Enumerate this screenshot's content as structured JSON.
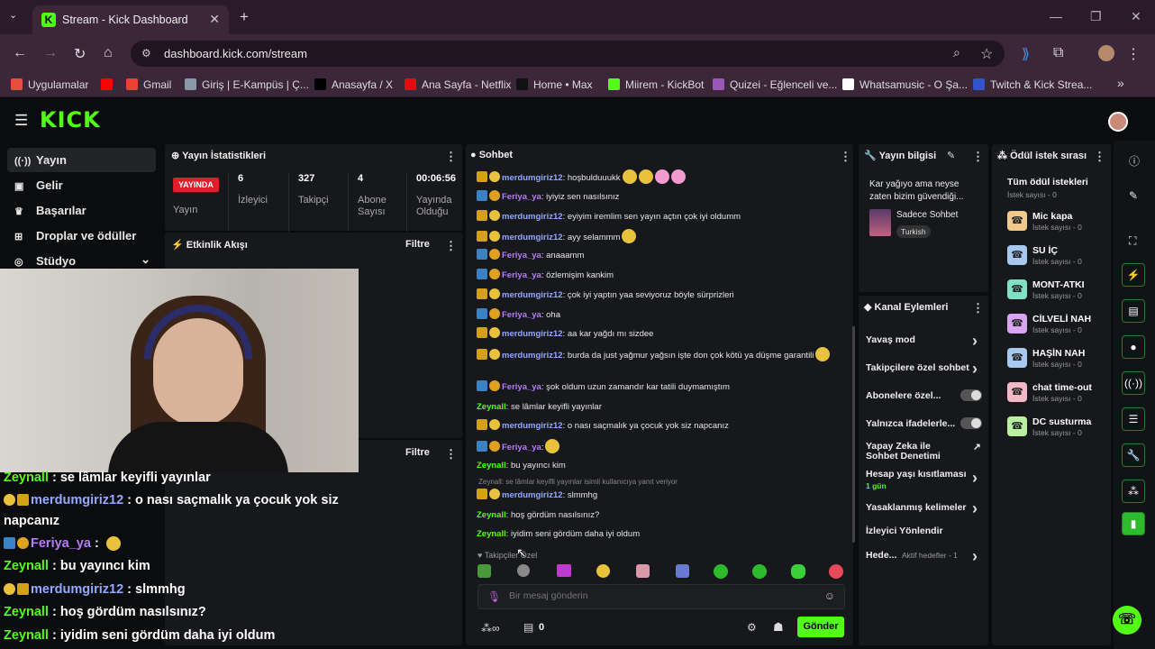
{
  "browser": {
    "tab_title": "Stream - Kick Dashboard",
    "url": "dashboard.kick.com/stream",
    "bookmarks": [
      {
        "label": "Uygulamalar",
        "color": "#e74c3c"
      },
      {
        "label": "",
        "color": "#ff0000"
      },
      {
        "label": "Gmail",
        "color": "#ea4335"
      },
      {
        "label": "Giriş | E-Kampüs | Ç...",
        "color": "#8899aa"
      },
      {
        "label": "Anasayfa / X",
        "color": "#000000"
      },
      {
        "label": "Ana Sayfa - Netflix",
        "color": "#e50914"
      },
      {
        "label": "Home • Max",
        "color": "#111111"
      },
      {
        "label": "Miirem - KickBot",
        "color": "#53fc18"
      },
      {
        "label": "Quizei - Eğlenceli ve...",
        "color": "#9b59b6"
      },
      {
        "label": "Whatsamusic - O Şa...",
        "color": "#ffffff"
      },
      {
        "label": "Twitch & Kick Strea...",
        "color": "#3355cc"
      }
    ]
  },
  "sidebar": {
    "items": [
      {
        "label": "Yayın",
        "icon": "broadcast-icon"
      },
      {
        "label": "Gelir",
        "icon": "revenue-icon"
      },
      {
        "label": "Başarılar",
        "icon": "trophy-icon"
      },
      {
        "label": "Droplar ve ödüller",
        "icon": "drops-icon"
      },
      {
        "label": "Stüdyo",
        "icon": "studio-icon"
      }
    ]
  },
  "stats": {
    "title": "Yayın İstatistikleri",
    "live_badge": "YAYINDA",
    "live_label": "Yayın",
    "cols": [
      {
        "value": "6",
        "label": "İzleyici"
      },
      {
        "value": "327",
        "label": "Takipçi"
      },
      {
        "value": "4",
        "label": "Abone Sayısı"
      },
      {
        "value": "00:06:56",
        "label": "Yayında Olduğu Süre"
      }
    ]
  },
  "activity": {
    "title": "Etkinlik Akışı",
    "filter": "Filtre"
  },
  "lower_panel": {
    "filter": "Filtre"
  },
  "chat": {
    "title": "Sohbet",
    "messages": [
      {
        "user": "merdumgiriz12",
        "type": "m",
        "text": ": hoşbulduuukk"
      },
      {
        "user": "Feriya_ya",
        "type": "f",
        "text": ": iyiyiz sen nasılsınız"
      },
      {
        "user": "merdumgiriz12",
        "type": "m",
        "text": ": eyiyim iremlim sen yayın açtın çok iyi oldumm"
      },
      {
        "user": "merdumgiriz12",
        "type": "m",
        "text": ": ayy selammm"
      },
      {
        "user": "Feriya_ya",
        "type": "f",
        "text": ": anaaamm"
      },
      {
        "user": "Feriya_ya",
        "type": "f",
        "text": ": özlemişim kankim"
      },
      {
        "user": "merdumgiriz12",
        "type": "m",
        "text": ": çok iyi yaptın yaa seviyoruz böyle sürprizleri"
      },
      {
        "user": "Feriya_ya",
        "type": "f",
        "text": ": oha"
      },
      {
        "user": "merdumgiriz12",
        "type": "m",
        "text": ": aa kar yağdı mı sizdee"
      },
      {
        "user": "merdumgiriz12",
        "type": "m",
        "text": ": burda da just yağmur yağsın işte  don çok kötü ya düşme garantili"
      },
      {
        "user": "Feriya_ya",
        "type": "f",
        "text": ": şok oldum uzun zamandır kar tatili duymamıştım"
      },
      {
        "user": "Zeynall",
        "type": "z",
        "text": ": se lâmlar keyifli yayınlar"
      },
      {
        "user": "merdumgiriz12",
        "type": "m",
        "text": ": o nası saçmalık ya çocuk yok siz napcanız"
      },
      {
        "user": "Feriya_ya",
        "type": "f",
        "text": ":"
      },
      {
        "user": "Zeynall",
        "type": "z",
        "text": ": bu yayıncı kim"
      },
      {
        "user": "merdumgiriz12",
        "type": "m",
        "text": ": slmmhg",
        "reply": "Zeynall: se lâmlar keyifli yayınlar isimli kullanıcıya yanıt veriyor"
      },
      {
        "user": "Zeynall",
        "type": "z",
        "text": ": hoş gördüm nasılsınız?"
      },
      {
        "user": "Zeynall",
        "type": "z",
        "text": ": iyidim seni gördüm daha iyi oldum"
      }
    ],
    "follower_mode": "Takipçiler Özel",
    "input_placeholder": "Bir mesaj gönderin",
    "points": "0",
    "send": "Gönder"
  },
  "overlay_chat": [
    {
      "user": "Zeynall",
      "type": "z",
      "text": " : se lâmlar keyifli yayınlar"
    },
    {
      "user": "merdumgiriz12",
      "type": "m",
      "text": " : o nası saçmalık ya çocuk yok siz"
    },
    {
      "user": "",
      "type": "cont",
      "text": "napcanız"
    },
    {
      "user": "Feriya_ya",
      "type": "f",
      "text": " :"
    },
    {
      "user": "Zeynall",
      "type": "z",
      "text": " : bu yayıncı kim"
    },
    {
      "user": "merdumgiriz12",
      "type": "m",
      "text": " : slmmhg"
    },
    {
      "user": "Zeynall",
      "type": "z",
      "text": " : hoş gördüm nasılsınız?"
    },
    {
      "user": "Zeynall",
      "type": "z",
      "text": " : iyidim seni gördüm daha iyi oldum"
    }
  ],
  "stream_info": {
    "title": "Yayın bilgisi",
    "stream_title": "Kar yağıyo ama neyse zaten bizim güvendiği...",
    "category": "Sadece Sohbet",
    "tag": "Turkish"
  },
  "channel_actions": {
    "title": "Kanal Eylemleri",
    "items": [
      {
        "label": "Yavaş mod",
        "kind": "chevron"
      },
      {
        "label": "Takipçilere özel sohbet",
        "kind": "chevron"
      },
      {
        "label": "Abonelere özel...",
        "kind": "toggle"
      },
      {
        "label": "Yalnızca ifadelerle...",
        "kind": "toggle"
      },
      {
        "label": "Yapay Zeka ile Sohbet Denetimi",
        "kind": "link"
      },
      {
        "label": "Hesap yaşı kısıtlaması",
        "kind": "chevron",
        "sub": "1 gün"
      },
      {
        "label": "Yasaklanmış kelimeler",
        "kind": "chevron"
      },
      {
        "label": "İzleyici Yönlendir",
        "kind": "none"
      },
      {
        "label": "Hede...",
        "kind": "chevron",
        "sub": "Aktif hedefler - 1"
      }
    ]
  },
  "rewards": {
    "title": "Ödül istek sırası",
    "all": "Tüm ödül istekleri",
    "all_count": "İstek sayısı - 0",
    "items": [
      {
        "name": "Mic kapa",
        "count": "İstek sayısı - 0",
        "color": "#f2c98a"
      },
      {
        "name": "SU İÇ",
        "count": "İstek sayısı - 0",
        "color": "#a9c8f0"
      },
      {
        "name": "MONT-ATKI",
        "count": "İstek sayısı - 0",
        "color": "#7fe0c4"
      },
      {
        "name": "CİLVELİ NAH",
        "count": "İstek sayısı - 0",
        "color": "#d9a4f0"
      },
      {
        "name": "HAŞİN NAH",
        "count": "İstek sayısı - 0",
        "color": "#a9c8f0"
      },
      {
        "name": "chat time-out",
        "count": "İstek sayısı - 0",
        "color": "#f5b8c8"
      },
      {
        "name": "DC susturma",
        "count": "İstek sayısı - 0",
        "color": "#b8f0a0"
      }
    ]
  }
}
